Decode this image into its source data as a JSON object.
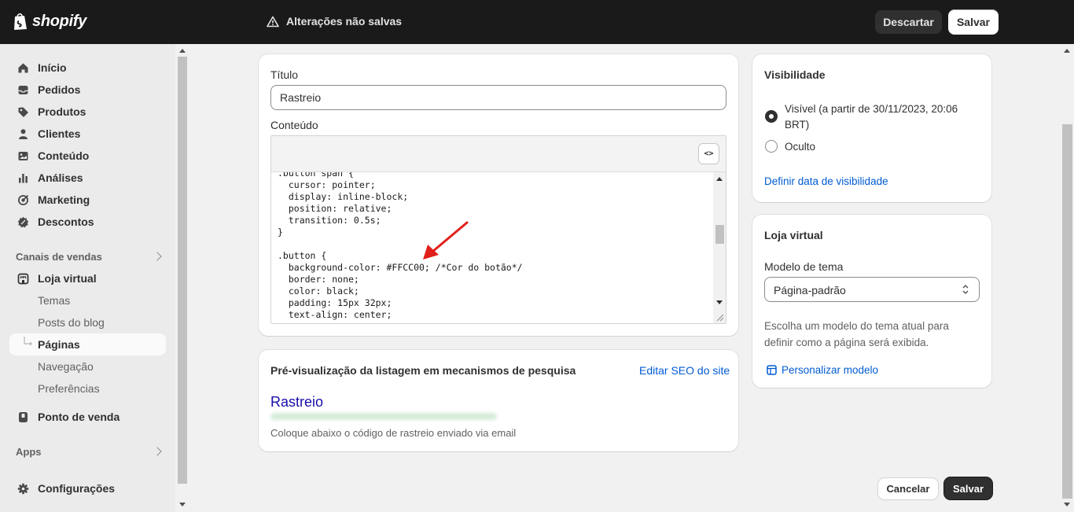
{
  "topbar": {
    "logo_text": "shopify",
    "unsaved_message": "Alterações não salvas",
    "discard_label": "Descartar",
    "save_label": "Salvar"
  },
  "sidebar": {
    "items": [
      {
        "label": "Início",
        "icon": "home-icon"
      },
      {
        "label": "Pedidos",
        "icon": "inbox-icon"
      },
      {
        "label": "Produtos",
        "icon": "tag-icon"
      },
      {
        "label": "Clientes",
        "icon": "person-icon"
      },
      {
        "label": "Conteúdo",
        "icon": "image-icon"
      },
      {
        "label": "Análises",
        "icon": "bar-chart-icon"
      },
      {
        "label": "Marketing",
        "icon": "target-icon"
      },
      {
        "label": "Descontos",
        "icon": "discount-icon"
      }
    ],
    "sales_channels_label": "Canais de vendas",
    "online_store": {
      "label": "Loja virtual",
      "sub_items": [
        "Temas",
        "Posts do blog",
        "Páginas",
        "Navegação",
        "Preferências"
      ],
      "active": "Páginas"
    },
    "pos_label": "Ponto de venda",
    "apps_label": "Apps",
    "settings_label": "Configurações"
  },
  "main_card": {
    "title_label": "Título",
    "title_value": "Rastreio",
    "content_label": "Conteúdo",
    "html_toggle_label": "<>",
    "code_lines": [
      ".button span {",
      "  cursor: pointer;",
      "  display: inline-block;",
      "  position: relative;",
      "  transition: 0.5s;",
      "}",
      "",
      ".button {",
      "  background-color: #FFCC00; /*Cor do botão*/",
      "  border: none;",
      "  color: black;",
      "  padding: 15px 32px;",
      "  text-align: center;"
    ]
  },
  "seo_card": {
    "heading": "Pré-visualização da listagem em mecanismos de pesquisa",
    "edit_link": "Editar SEO do site",
    "preview_title": "Rastreio",
    "preview_description": "Coloque abaixo o código de rastreio enviado via email"
  },
  "visibility_card": {
    "heading": "Visibilidade",
    "visible_label": "Visível (a partir de 30/11/2023, 20:06",
    "visible_label_line2": "BRT)",
    "hidden_label": "Oculto",
    "selected": "visible",
    "set_date_link": "Definir data de visibilidade"
  },
  "online_store_card": {
    "heading": "Loja virtual",
    "template_label": "Modelo de tema",
    "template_value": "Página-padrão",
    "help_text_line1": "Escolha um modelo do tema atual para",
    "help_text_line2": "definir como a página será exibida.",
    "customize_link": "Personalizar modelo"
  },
  "footer": {
    "cancel_label": "Cancelar",
    "save_label": "Salvar"
  },
  "colors": {
    "topbar_bg": "#1a1a1a",
    "link": "#005bd3",
    "annotation_arrow": "#e0201b",
    "seo_title": "#1a0dab"
  }
}
